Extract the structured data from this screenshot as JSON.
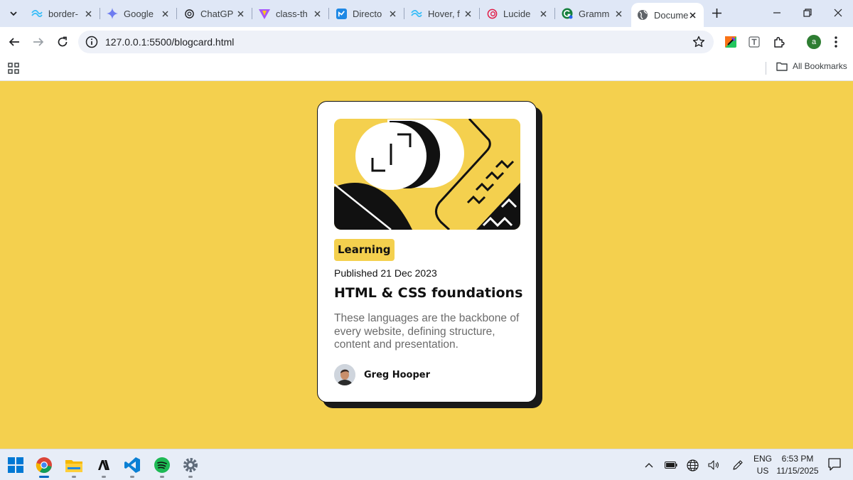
{
  "browser": {
    "tabs": [
      {
        "title": "border-",
        "icon": "tailwind-icon"
      },
      {
        "title": "Google",
        "icon": "gemini-icon"
      },
      {
        "title": "ChatGP",
        "icon": "chatgpt-icon"
      },
      {
        "title": "class-th",
        "icon": "vite-icon"
      },
      {
        "title": "Directo",
        "icon": "directory-icon"
      },
      {
        "title": "Hover, f",
        "icon": "tailwind-icon"
      },
      {
        "title": "Lucide",
        "icon": "lucide-icon"
      },
      {
        "title": "Gramm",
        "icon": "grammarly-icon"
      },
      {
        "title": "Docume",
        "icon": "globe-icon",
        "active": true
      }
    ],
    "url": "127.0.0.1:5500/blogcard.html",
    "profile_initial": "a",
    "bookmarks_label": "All Bookmarks"
  },
  "card": {
    "tag": "Learning",
    "published": "Published 21 Dec 2023",
    "title": "HTML & CSS foundations",
    "description": "These languages are the backbone of every website, defining structure, content and presentation.",
    "author": "Greg Hooper"
  },
  "taskbar": {
    "apps": [
      "windows-start-icon",
      "chrome-icon",
      "file-explorer-icon",
      "anthropic-icon",
      "vscode-icon",
      "spotify-icon",
      "settings-icon"
    ],
    "language": "ENG",
    "region": "US",
    "time": "6:53 PM",
    "date": "11/15/2025"
  },
  "colors": {
    "page_background": "#f4d04e",
    "tab_strip": "#dfe7f6",
    "card_text": "#111111",
    "description_text": "#6b6b6b",
    "windows_accent": "#0067c0"
  }
}
